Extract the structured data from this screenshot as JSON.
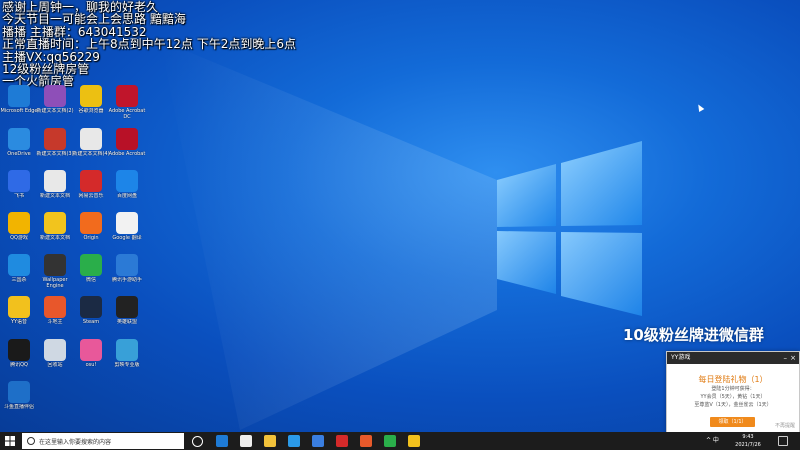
{
  "overlay": {
    "lines": [
      "感谢上周钟一，聊我的好老久",
      "今天节目一可能会上会思路 黯黯海",
      "播播 主播群：643041532",
      "正常直播时间：上午8点到中午12点 下午2点到晚上6点",
      "主播VX:qq56229",
      "12级粉丝牌房管",
      "一个火箭房管"
    ]
  },
  "desktop_icons": [
    {
      "label": "Microsoft Edge",
      "icon": "edge-icon",
      "color": "#1e7bd6"
    },
    {
      "label": "新建文本文档(2)",
      "icon": "folder-icon",
      "color": "#8e4fb8"
    },
    {
      "label": "谷歌浏览器",
      "icon": "chrome-icon",
      "color": "#ecc012"
    },
    {
      "label": "Adobe Acrobat DC",
      "icon": "adobe-icon",
      "color": "#c0152b"
    },
    {
      "label": "OneDrive",
      "icon": "onedrive-icon",
      "color": "#2b8be0"
    },
    {
      "label": "新建文本文档(3)",
      "icon": "text-file-icon",
      "color": "#c6392b"
    },
    {
      "label": "新建文本文档(4)",
      "icon": "text-file-icon",
      "color": "#e8e8e8"
    },
    {
      "label": "Adobe Acrobat",
      "icon": "adobe-icon",
      "color": "#b81127"
    },
    {
      "label": "飞书",
      "icon": "feishu-icon",
      "color": "#2f6ae6"
    },
    {
      "label": "新建文本文档",
      "icon": "text-file-icon",
      "color": "#e8e8e8"
    },
    {
      "label": "网易云音乐",
      "icon": "netease-music-icon",
      "color": "#d42a2a"
    },
    {
      "label": "百度网盘",
      "icon": "baidu-netdisk-icon",
      "color": "#1d85e8"
    },
    {
      "label": "QQ游戏",
      "icon": "qq-game-icon",
      "color": "#f2b400"
    },
    {
      "label": "新建文本文档",
      "icon": "text-file-icon",
      "color": "#f2c41d"
    },
    {
      "label": "Origin",
      "icon": "origin-icon",
      "color": "#f26b1d"
    },
    {
      "label": "Google 翻译",
      "icon": "translate-icon",
      "color": "#f2f2f2"
    },
    {
      "label": "三国杀",
      "icon": "ie-icon",
      "color": "#1f8be0"
    },
    {
      "label": "Wallpaper Engine",
      "icon": "wallpaper-icon",
      "color": "#333333"
    },
    {
      "label": "微信",
      "icon": "wechat-icon",
      "color": "#2aae4a"
    },
    {
      "label": "腾讯手游助手",
      "icon": "emulator-icon",
      "color": "#2b7ad6"
    },
    {
      "label": "YY语音",
      "icon": "yy-icon",
      "color": "#f2c11d"
    },
    {
      "label": "斗地主",
      "icon": "game-icon",
      "color": "#e8572b"
    },
    {
      "label": "Steam",
      "icon": "steam-icon",
      "color": "#1b2a44"
    },
    {
      "label": "英雄联盟",
      "icon": "lol-icon",
      "color": "#222222"
    },
    {
      "label": "腾讯QQ",
      "icon": "qq-icon",
      "color": "#1a1a1a"
    },
    {
      "label": "回收站",
      "icon": "recycle-bin-icon",
      "color": "#cfd8e3"
    },
    {
      "label": "osu!",
      "icon": "osu-icon",
      "color": "#e8589a"
    },
    {
      "label": "剪映专业版",
      "icon": "capcut-icon",
      "color": "#38a0d8"
    },
    {
      "label": "斗鱼直播伴侣",
      "icon": "douyu-icon",
      "color": "#1e6fc8"
    }
  ],
  "promo_text": "10级粉丝牌进微信群",
  "popup": {
    "app_name": "YY游戏",
    "title": "每日登陆礼物（1）",
    "lines": [
      "登陆1分钟可获得：",
      "YY会员（5天），黄钻（1天）",
      "至尊蓝V（1天），金丝雀云（1天）"
    ],
    "button_label": "领取（1/1）",
    "note": "不再提醒"
  },
  "taskbar": {
    "search_placeholder": "在这里输入你要搜索的内容",
    "pinned": [
      {
        "name": "task-view-icon",
        "color": "#ffffff"
      },
      {
        "name": "edge-icon",
        "color": "#1e7bd6"
      },
      {
        "name": "store-icon",
        "color": "#eeeeee"
      },
      {
        "name": "explorer-icon",
        "color": "#f2c23a"
      },
      {
        "name": "edge-browser-icon",
        "color": "#2b9ae8"
      },
      {
        "name": "mail-icon",
        "color": "#3a7ee0"
      },
      {
        "name": "app-red-icon",
        "color": "#d42a2a"
      },
      {
        "name": "recorder-icon",
        "color": "#e85a2b"
      },
      {
        "name": "green-app-icon",
        "color": "#2aae4a"
      },
      {
        "name": "stream-app-icon",
        "color": "#f2c11d"
      }
    ],
    "tray": "^ 中 ",
    "clock_time": "9:43",
    "clock_date": "2021/7/26"
  }
}
